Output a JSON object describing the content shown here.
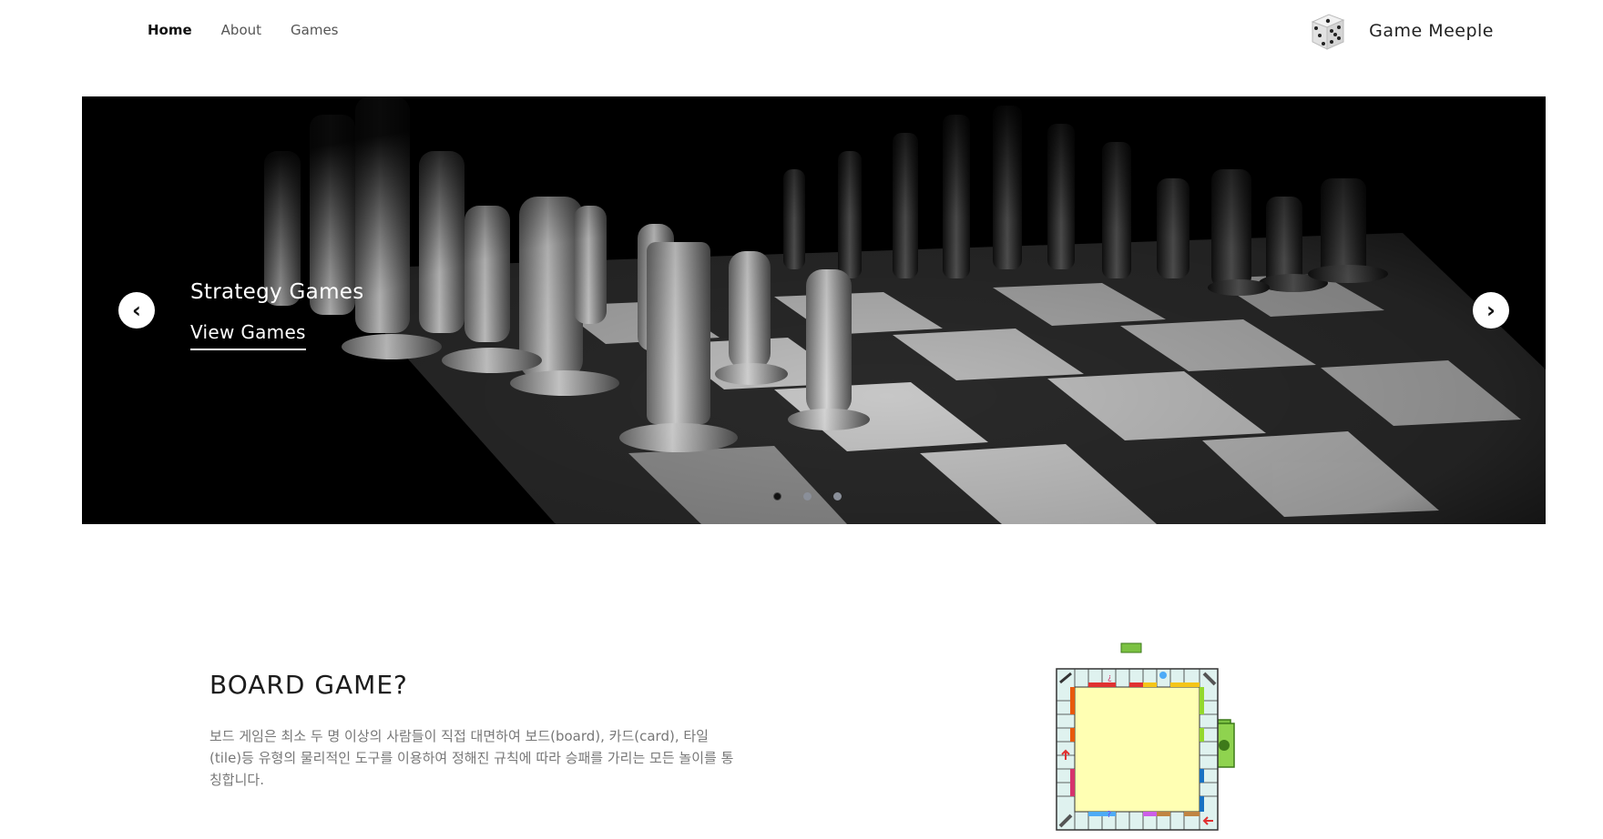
{
  "nav": {
    "links": [
      {
        "label": "Home",
        "active": true
      },
      {
        "label": "About",
        "active": false
      },
      {
        "label": "Games",
        "active": false
      }
    ],
    "brand": "Game Meeple",
    "logo_icon": "dice-icon"
  },
  "hero": {
    "slide_title": "Strategy Games",
    "cta_label": "View Games",
    "prev_symbol": "‹",
    "next_symbol": "›",
    "slide_count": 3,
    "active_slide": 1
  },
  "about": {
    "title": "BOARD GAME?",
    "body": "보드 게임은 최소 두 명 이상의 사람들이 직접 대면하여 보드(board), 카드(card), 타일(tile)등 유형의 물리적인 도구를 이용하여 정해진 규칙에 따라 승패를 가리는 모든 놀이를 통칭합니다."
  },
  "colors": {
    "hero_bg": "#000000",
    "board_fill": "#ffffb3",
    "money_green": "#7bc142"
  }
}
